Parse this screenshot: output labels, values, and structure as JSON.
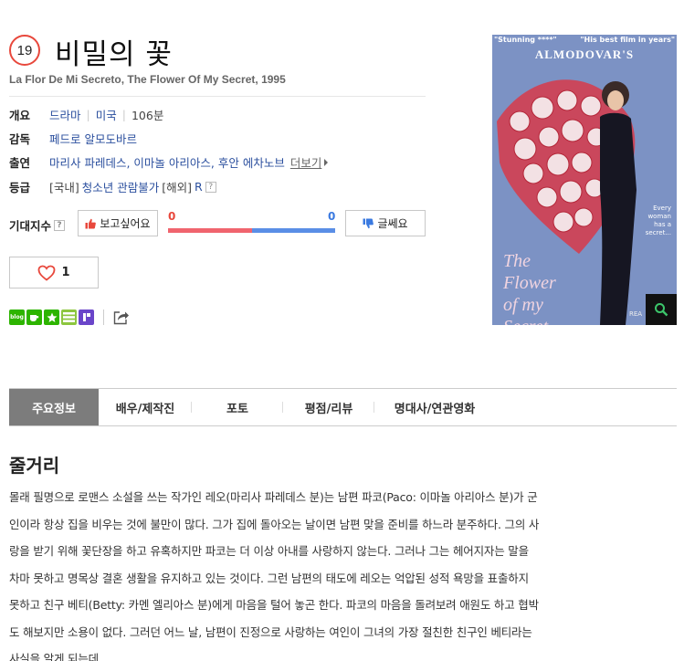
{
  "movie": {
    "age_rating": "19",
    "title": "비밀의 꽃",
    "original_title": "La Flor De Mi Secreto, The Flower Of My Secret, 1995"
  },
  "info": {
    "overview_label": "개요",
    "genre": "드라마",
    "country": "미국",
    "runtime": "106분",
    "director_label": "감독",
    "director": "페드로 알모도바르",
    "cast_label": "출연",
    "cast": "마리사 파레데스, 이마놀 아리아스, 후안 에차노브",
    "more_label": "더보기",
    "rating_label": "등급",
    "rating_domestic_prefix": "[국내]",
    "rating_domestic": "청소년 관람불가",
    "rating_foreign_prefix": "[해외]",
    "rating_foreign": "R"
  },
  "expectation": {
    "label": "기대지수",
    "want_label": "보고싶어요",
    "nah_label": "글쎄요",
    "want_count": "0",
    "nah_count": "0",
    "want_fraction": 0.5
  },
  "like": {
    "count": "1"
  },
  "share": {
    "icons": [
      "blog-icon",
      "cafe-icon",
      "bookmark-icon",
      "line-icon",
      "band-icon"
    ]
  },
  "poster": {
    "quote_left": "\"Stunning ****\"",
    "quote_right": "\"His best film in years\"",
    "director_text": "ALMODOVAR'S",
    "tagline": "Every\nwoman\nhas a\nsecret...",
    "title_text": "The\nFlower\nof my\nSecret",
    "credits": "REA"
  },
  "tabs": [
    {
      "label": "주요정보",
      "active": true
    },
    {
      "label": "배우/제작진",
      "active": false
    },
    {
      "label": "포토",
      "active": false
    },
    {
      "label": "평점/리뷰",
      "active": false
    },
    {
      "label": "명대사/연관영화",
      "active": false
    }
  ],
  "plot": {
    "heading": "줄거리",
    "lines": [
      "몰래 필명으로 로맨스 소설을 쓰는 작가인 레오(마리사 파레데스 분)는 남편 파코(Paco: 이마놀 아리아스 분)가 군",
      "인이라 항상 집을 비우는 것에 불만이 많다. 그가 집에 돌아오는 날이면 남편 맞을 준비를 하느라 분주하다. 그의 사",
      "랑을 받기 위해 꽃단장을 하고 유혹하지만 파코는 더 이상 아내를 사랑하지 않는다. 그러나 그는 헤어지자는 말을",
      "차마 못하고 명목상 결혼 생활을 유지하고 있는 것이다. 그런 남편의 태도에 레오는 억압된 성적 욕망을 표출하지",
      "못하고 친구 베티(Betty: 카멘 엘리아스 분)에게 마음을 털어 놓곤 한다. 파코의 마음을 돌려보려 애원도 하고 협박",
      "도 해보지만 소용이 없다. 그러던 어느 날, 남편이 진정으로 사랑하는 여인이 그녀의 가장 절친한 친구인 베티라는",
      "사실을 알게 되는데."
    ]
  },
  "colors": {
    "accent_red": "#e8483c",
    "accent_blue": "#3b7ae0",
    "link": "#2b4f9e",
    "tab_active": "#7c7c7c"
  }
}
